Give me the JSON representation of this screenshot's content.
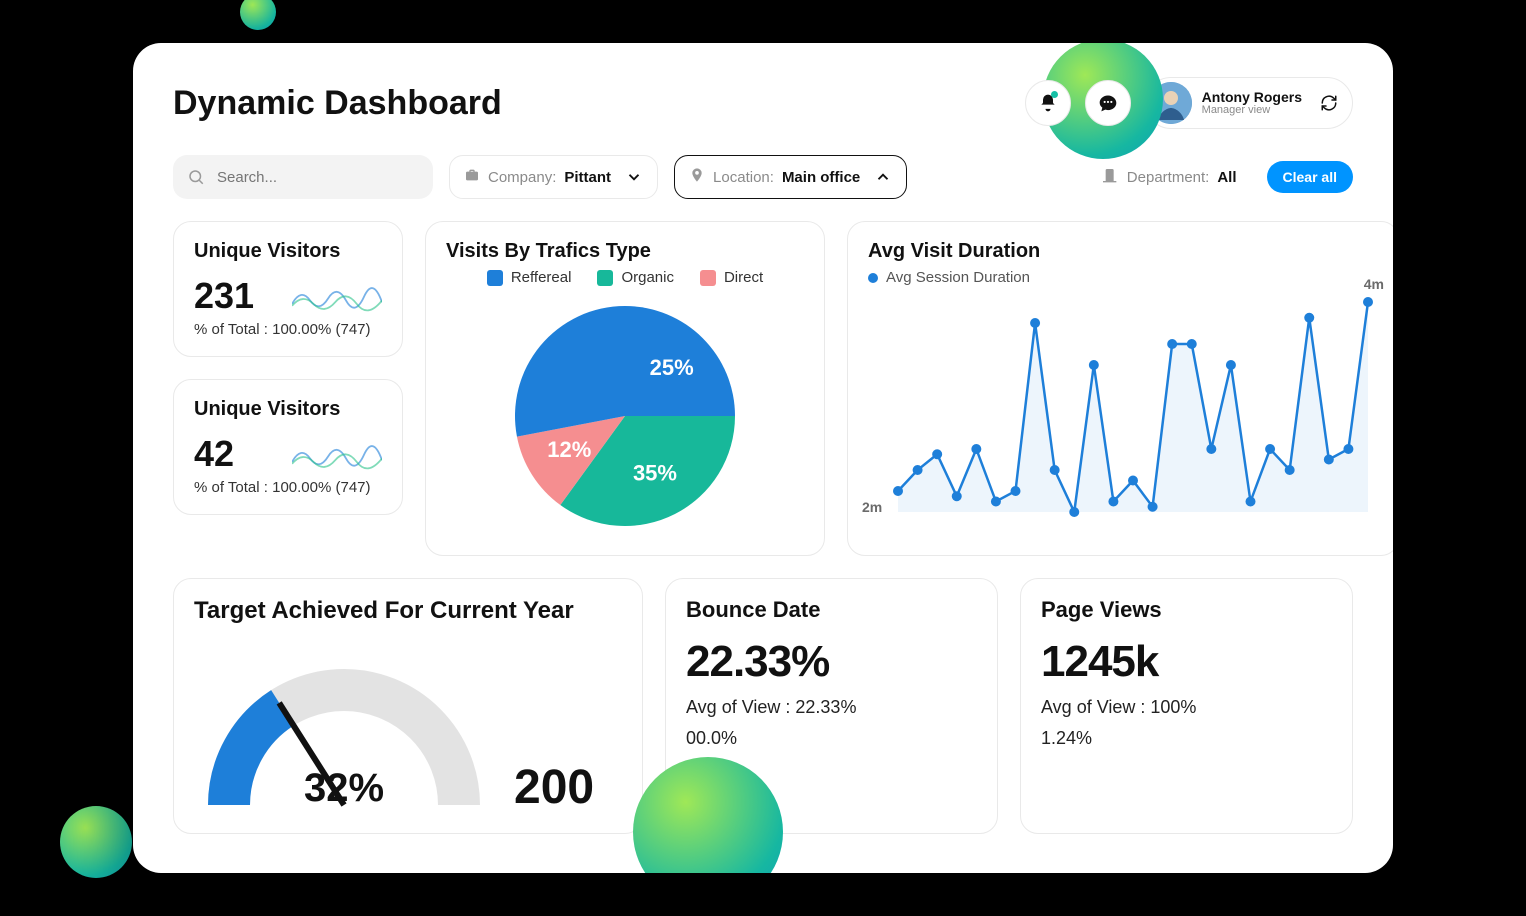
{
  "header": {
    "title": "Dynamic Dashboard",
    "user_name": "Antony Rogers",
    "user_role": "Manager view"
  },
  "search": {
    "placeholder": "Search..."
  },
  "filters": {
    "company_label": "Company:",
    "company_value": "Pittant",
    "location_label": "Location:",
    "location_value": "Main office",
    "department_label": "Department:",
    "department_value": "All",
    "clear": "Clear all"
  },
  "cards": {
    "uv1": {
      "title": "Unique Visitors",
      "value": "231",
      "sub": "% of Total : 100.00% (747)"
    },
    "uv2": {
      "title": "Unique Visitors",
      "value": "42",
      "sub": "% of Total : 100.00% (747)"
    },
    "traffic": {
      "title": "Visits By Trafics Type",
      "legend": {
        "a": "Reffereal",
        "b": "Organic",
        "c": "Direct"
      }
    },
    "avg": {
      "title": "Avg Visit Duration",
      "series_name": "Avg Session Duration",
      "y_min_label": "2m",
      "y_max_label": "4m"
    },
    "target": {
      "title": "Target Achieved For Current Year",
      "side_value": "200"
    },
    "bounce": {
      "title": "Bounce Date",
      "value": "22.33%",
      "line1": "Avg of View : 22.33%",
      "line2": "00.0%"
    },
    "views": {
      "title": "Page Views",
      "value": "1245k",
      "line1": "Avg of View : 100%",
      "line2": "1.24%"
    }
  },
  "chart_data": [
    {
      "type": "pie",
      "title": "Visits By Trafics Type",
      "series": [
        {
          "name": "Reffereal",
          "value": 25,
          "unit": "%",
          "color": "#1E7FD9"
        },
        {
          "name": "Organic",
          "value": 35,
          "unit": "%",
          "color": "#17B89A"
        },
        {
          "name": "Direct",
          "value": 12,
          "unit": "%",
          "color": "#F58E90"
        }
      ]
    },
    {
      "type": "line",
      "title": "Avg Visit Duration",
      "ylabel": "minutes",
      "ylim": [
        2,
        4
      ],
      "series": [
        {
          "name": "Avg Session Duration",
          "values": [
            2.2,
            2.4,
            2.55,
            2.15,
            2.6,
            2.1,
            2.2,
            3.8,
            2.4,
            2.0,
            3.4,
            2.1,
            2.3,
            2.05,
            3.6,
            3.6,
            2.6,
            3.4,
            2.1,
            2.6,
            2.4,
            3.85,
            2.5,
            2.6,
            4.0
          ]
        }
      ]
    },
    {
      "type": "gauge",
      "title": "Target Achieved For Current Year",
      "value": 32,
      "min": 0,
      "max": 100,
      "unit": "%"
    }
  ]
}
